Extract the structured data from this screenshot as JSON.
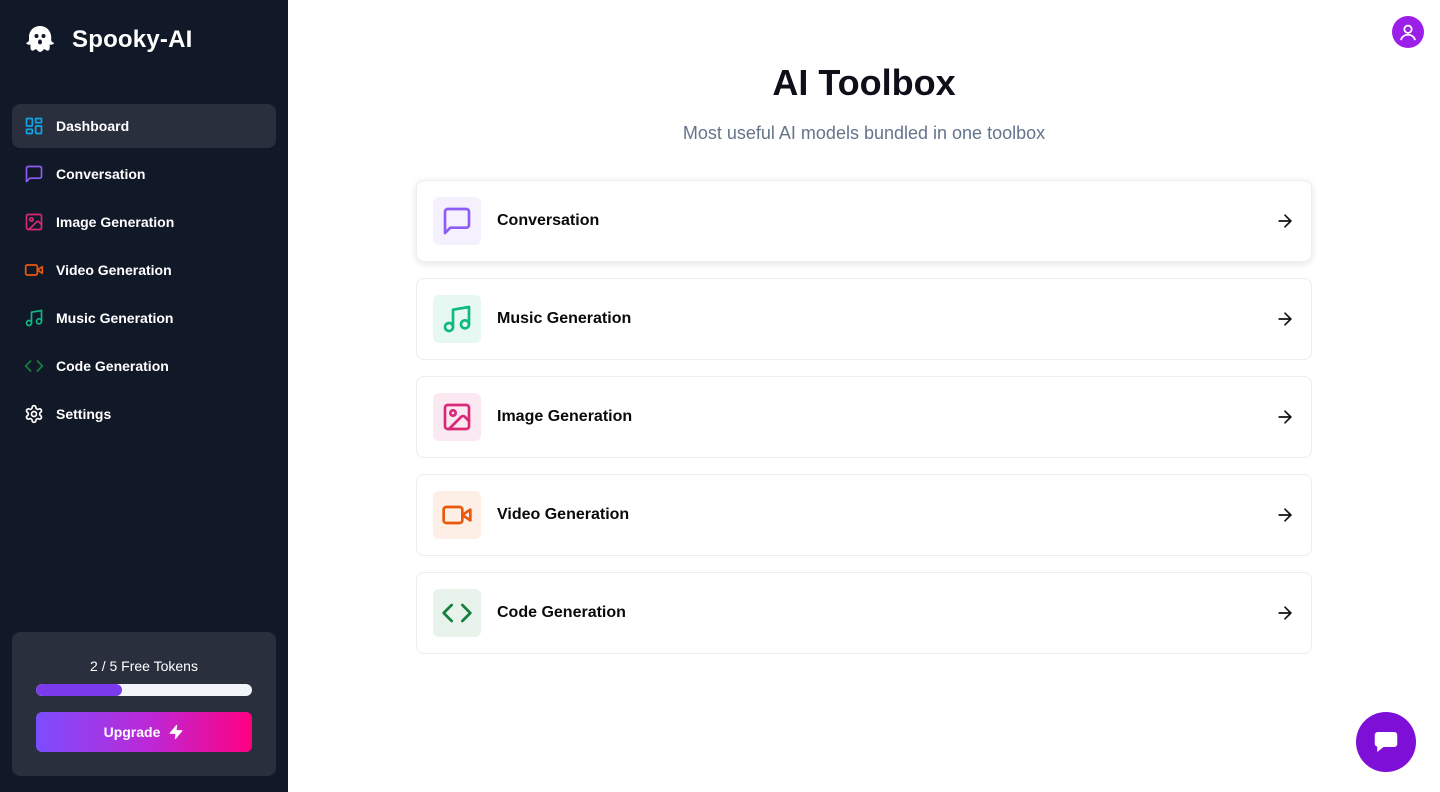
{
  "app": {
    "brand_name": "Spooky-AI"
  },
  "sidebar": {
    "items": [
      {
        "label": "Dashboard",
        "icon": "dashboard-icon",
        "color": "#0ea5e9",
        "active": true
      },
      {
        "label": "Conversation",
        "icon": "message-square-icon",
        "color": "#8b5cf6"
      },
      {
        "label": "Image Generation",
        "icon": "image-icon",
        "color": "#db2777"
      },
      {
        "label": "Video Generation",
        "icon": "video-icon",
        "color": "#ea580c"
      },
      {
        "label": "Music Generation",
        "icon": "music-icon",
        "color": "#10b981"
      },
      {
        "label": "Code Generation",
        "icon": "code-icon",
        "color": "#15803d"
      },
      {
        "label": "Settings",
        "icon": "settings-icon",
        "color": "#ffffff"
      }
    ],
    "tokens": {
      "text": "2 / 5 Free Tokens",
      "used": 2,
      "total": 5,
      "upgrade_label": "Upgrade"
    }
  },
  "main": {
    "title": "AI Toolbox",
    "subtitle": "Most useful AI models bundled in one toolbox",
    "tools": [
      {
        "label": "Conversation",
        "icon": "message-square-icon",
        "color": "#8b5cf6",
        "bg": "#f5f0fe"
      },
      {
        "label": "Music Generation",
        "icon": "music-icon",
        "color": "#10b981",
        "bg": "#e7f8f2"
      },
      {
        "label": "Image Generation",
        "icon": "image-icon",
        "color": "#db2777",
        "bg": "#fbe9f1"
      },
      {
        "label": "Video Generation",
        "icon": "video-icon",
        "color": "#ea580c",
        "bg": "#fdeee6"
      },
      {
        "label": "Code Generation",
        "icon": "code-icon",
        "color": "#15803d",
        "bg": "#e8f3ec"
      }
    ]
  },
  "colors": {
    "sidebar_bg": "#111827",
    "accent": "#7c3aed",
    "avatar": "#9b1fe8",
    "chat_fab": "#7e0fd6"
  }
}
